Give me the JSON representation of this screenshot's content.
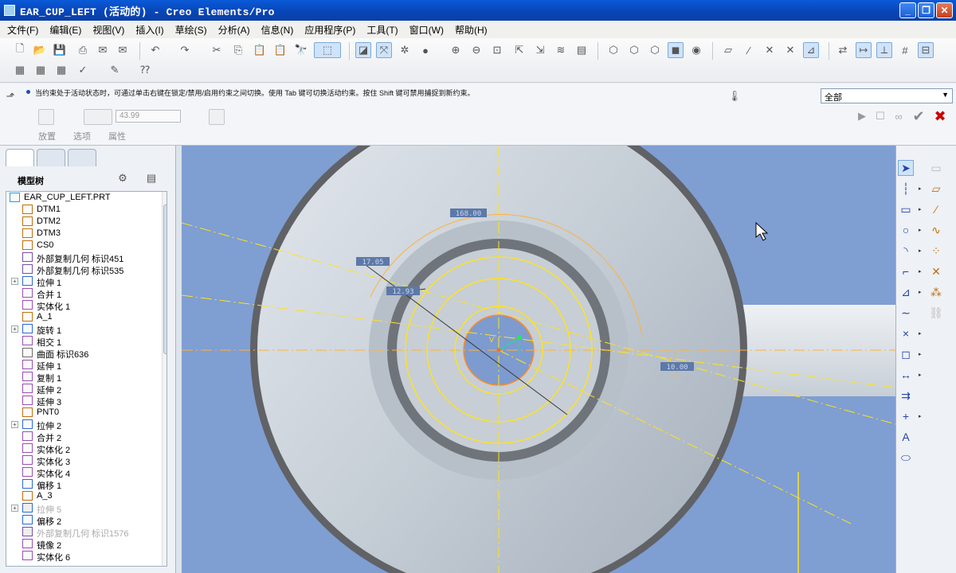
{
  "window": {
    "title": "EAR_CUP_LEFT (活动的) - Creo Elements/Pro"
  },
  "menu": [
    "文件(F)",
    "编辑(E)",
    "视图(V)",
    "插入(I)",
    "草绘(S)",
    "分析(A)",
    "信息(N)",
    "应用程序(P)",
    "工具(T)",
    "窗口(W)",
    "帮助(H)"
  ],
  "message": "当约束处于活动状态时，可通过单击右键在锁定/禁用/启用约束之间切换。使用 Tab 键可切换活动约束。按住 Shift 键可禁用捕捉到新约束。",
  "filter": {
    "value": "全部"
  },
  "dashboard": {
    "value": "43.99",
    "tabs": [
      "放置",
      "选项",
      "属性"
    ]
  },
  "panel": {
    "header": "模型树"
  },
  "tree": [
    {
      "label": "EAR_CUP_LEFT.PRT",
      "icon": "part-icon",
      "exp": ""
    },
    {
      "label": "DTM1",
      "icon": "datum-plane-icon",
      "exp": ""
    },
    {
      "label": "DTM2",
      "icon": "datum-plane-icon",
      "exp": ""
    },
    {
      "label": "DTM3",
      "icon": "datum-plane-icon",
      "exp": ""
    },
    {
      "label": "CS0",
      "icon": "coord-system-icon",
      "exp": ""
    },
    {
      "label": "外部复制几何 标识451",
      "icon": "external-copy-icon",
      "exp": ""
    },
    {
      "label": "外部复制几何 标识535",
      "icon": "external-copy-icon",
      "exp": ""
    },
    {
      "label": "拉伸 1",
      "icon": "extrude-icon",
      "exp": "+"
    },
    {
      "label": "合并 1",
      "icon": "merge-icon",
      "exp": ""
    },
    {
      "label": "实体化 1",
      "icon": "solidify-icon",
      "exp": ""
    },
    {
      "label": "A_1",
      "icon": "axis-icon",
      "exp": ""
    },
    {
      "label": "旋转 1",
      "icon": "revolve-icon",
      "exp": "+"
    },
    {
      "label": "相交 1",
      "icon": "intersect-icon",
      "exp": ""
    },
    {
      "label": "曲面 标识636",
      "icon": "surface-icon",
      "exp": ""
    },
    {
      "label": "延伸 1",
      "icon": "extend-icon",
      "exp": ""
    },
    {
      "label": "复制 1",
      "icon": "copy-icon",
      "exp": ""
    },
    {
      "label": "延伸 2",
      "icon": "extend-icon",
      "exp": ""
    },
    {
      "label": "延伸 3",
      "icon": "extend-icon",
      "exp": ""
    },
    {
      "label": "PNT0",
      "icon": "point-icon",
      "exp": ""
    },
    {
      "label": "拉伸 2",
      "icon": "extrude-icon",
      "exp": "+"
    },
    {
      "label": "合并 2",
      "icon": "merge-icon",
      "exp": ""
    },
    {
      "label": "实体化 2",
      "icon": "solidify-icon",
      "exp": ""
    },
    {
      "label": "实体化 3",
      "icon": "solidify-icon",
      "exp": ""
    },
    {
      "label": "实体化 4",
      "icon": "solidify-icon",
      "exp": ""
    },
    {
      "label": "偏移 1",
      "icon": "offset-icon",
      "exp": ""
    },
    {
      "label": "A_3",
      "icon": "axis-icon",
      "exp": ""
    },
    {
      "label": "拉伸 5",
      "icon": "extrude-icon",
      "exp": "+",
      "dim": true
    },
    {
      "label": "偏移 2",
      "icon": "offset-icon",
      "exp": ""
    },
    {
      "label": "外部复制几何 标识1576",
      "icon": "external-copy-icon",
      "exp": "",
      "dim": true
    },
    {
      "label": "镜像 2",
      "icon": "mirror-icon",
      "exp": ""
    },
    {
      "label": "实体化 6",
      "icon": "solidify-icon",
      "exp": ""
    }
  ],
  "dims": {
    "d1": "168.00",
    "d2": "17.05",
    "d3": "12.93",
    "d4": "10.00"
  },
  "colors": {
    "sketch": "#ffe31a",
    "viewport_bg": "#7f9ed2",
    "title_bar": "#0a4fc8",
    "part": "#c3ced8"
  }
}
